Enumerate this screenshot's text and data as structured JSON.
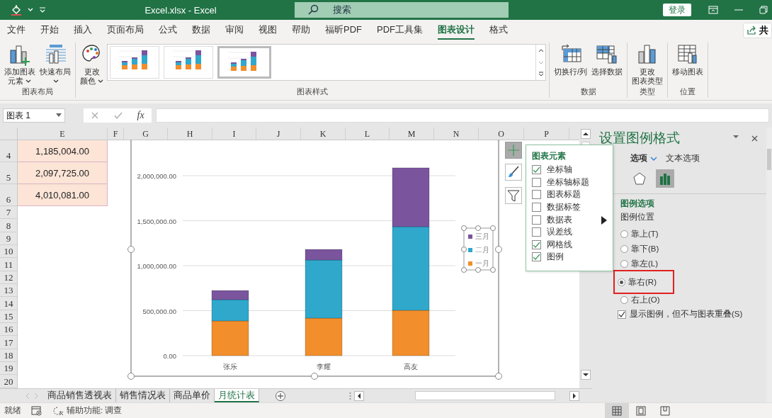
{
  "title_bar": {
    "title": "Excel.xlsx  -  Excel",
    "search_placeholder": "搜索",
    "sign_in": "登录"
  },
  "menu_tabs": [
    {
      "label": "文件",
      "selected": false
    },
    {
      "label": "开始",
      "selected": false
    },
    {
      "label": "插入",
      "selected": false
    },
    {
      "label": "页面布局",
      "selected": false
    },
    {
      "label": "公式",
      "selected": false
    },
    {
      "label": "数据",
      "selected": false
    },
    {
      "label": "审阅",
      "selected": false
    },
    {
      "label": "视图",
      "selected": false
    },
    {
      "label": "帮助",
      "selected": false
    },
    {
      "label": "福昕PDF",
      "selected": false
    },
    {
      "label": "PDF工具集",
      "selected": false
    },
    {
      "label": "图表设计",
      "selected": true
    },
    {
      "label": "格式",
      "selected": false
    }
  ],
  "share_label": "共",
  "ribbon_groups": [
    {
      "label": "图表布局",
      "kind": "buttons",
      "buttons": [
        {
          "lines": [
            "添加图表",
            "元素"
          ],
          "dropdown": true
        },
        {
          "lines": [
            "快速布局"
          ],
          "dropdown": true
        }
      ]
    },
    {
      "label": "图表样式",
      "kind": "styles",
      "buttons": [
        {
          "lines": [
            "更改",
            "颜色"
          ],
          "dropdown": true
        }
      ],
      "styles": [
        {
          "selected": false
        },
        {
          "selected": false
        },
        {
          "selected": true
        }
      ]
    },
    {
      "label": "数据",
      "kind": "buttons",
      "buttons": [
        {
          "lines": [
            "切换行/列"
          ],
          "dropdown": false
        },
        {
          "lines": [
            "选择数据"
          ],
          "dropdown": false
        }
      ]
    },
    {
      "label": "类型",
      "kind": "buttons",
      "buttons": [
        {
          "lines": [
            "更改",
            "图表类型"
          ],
          "dropdown": false
        }
      ]
    },
    {
      "label": "位置",
      "kind": "buttons",
      "buttons": [
        {
          "lines": [
            "移动图表"
          ],
          "dropdown": false
        }
      ]
    }
  ],
  "name_box": "图表 1",
  "formula_fx": "fx",
  "columns": [
    "E",
    "F",
    "G",
    "H",
    "I",
    "J",
    "K",
    "L",
    "M",
    "N",
    "O",
    "P"
  ],
  "rows": [
    {
      "number": "4",
      "value": "1,185,004.00"
    },
    {
      "number": "5",
      "value": "2,097,725.00"
    },
    {
      "number": "6",
      "value": "4,010,081.00"
    },
    {
      "number": "7"
    },
    {
      "number": "8"
    },
    {
      "number": "9"
    },
    {
      "number": "10"
    },
    {
      "number": "11"
    },
    {
      "number": "12"
    },
    {
      "number": "13"
    },
    {
      "number": "14"
    },
    {
      "number": "15"
    },
    {
      "number": "16"
    },
    {
      "number": "17"
    },
    {
      "number": "18"
    },
    {
      "number": "19"
    },
    {
      "number": "20"
    }
  ],
  "chart": {
    "chart_data": {
      "type": "bar",
      "stacked": true,
      "categories": [
        "张乐",
        "李耀",
        "高友"
      ],
      "series": [
        {
          "name": "一月",
          "color": "#f28e2b",
          "values": [
            386000,
            417000,
            504000
          ]
        },
        {
          "name": "二月",
          "color": "#2fa8cc",
          "values": [
            236000,
            646000,
            929000
          ]
        },
        {
          "name": "三月",
          "color": "#7a559e",
          "values": [
            102000,
            118000,
            654000
          ]
        }
      ],
      "ylim": [
        0,
        2100000
      ],
      "grid": true,
      "legend": true,
      "yticks": [
        {
          "value": 0,
          "label": "0.00"
        },
        {
          "value": 500000,
          "label": "500,000.00"
        },
        {
          "value": 1000000,
          "label": "1,000,000.00"
        },
        {
          "value": 1500000,
          "label": "1,500,000.00"
        },
        {
          "value": 2000000,
          "label": "2,000,000.00"
        }
      ]
    },
    "legend_selected": true
  },
  "chart_elements": {
    "title": "图表元素",
    "items": [
      {
        "label": "坐标轴",
        "checked": true
      },
      {
        "label": "坐标轴标题",
        "checked": false
      },
      {
        "label": "图表标题",
        "checked": false
      },
      {
        "label": "数据标签",
        "checked": false
      },
      {
        "label": "数据表",
        "checked": false
      },
      {
        "label": "误差线",
        "checked": false
      },
      {
        "label": "网格线",
        "checked": true
      },
      {
        "label": "图例",
        "checked": true
      }
    ]
  },
  "format_pane": {
    "title": "设置图例格式",
    "tabs": [
      {
        "label": "选项",
        "selected": true
      },
      {
        "label": "文本选项",
        "selected": false
      }
    ],
    "section": "图例选项",
    "subtitle": "图例位置",
    "positions": [
      {
        "label": "靠上(T)",
        "selected": false,
        "highlighted": false
      },
      {
        "label": "靠下(B)",
        "selected": false,
        "highlighted": false
      },
      {
        "label": "靠左(L)",
        "selected": false,
        "highlighted": false
      },
      {
        "label": "靠右(R)",
        "selected": true,
        "highlighted": true
      },
      {
        "label": "右上(O)",
        "selected": false,
        "highlighted": false
      }
    ],
    "no_overlap": {
      "label": "显示图例，但不与图表重叠(S)",
      "checked": true
    }
  },
  "sheet_tabs": [
    {
      "label": "商品销售透视表",
      "selected": false
    },
    {
      "label": "销售情况表",
      "selected": false
    },
    {
      "label": "商品单价",
      "selected": false
    },
    {
      "label": "月统计表",
      "selected": true
    }
  ],
  "status_bar": {
    "ready": "就绪",
    "accessibility": "辅助功能: 调查"
  },
  "view_buttons": [
    {
      "selected": true
    },
    {
      "selected": false
    },
    {
      "selected": false
    }
  ]
}
